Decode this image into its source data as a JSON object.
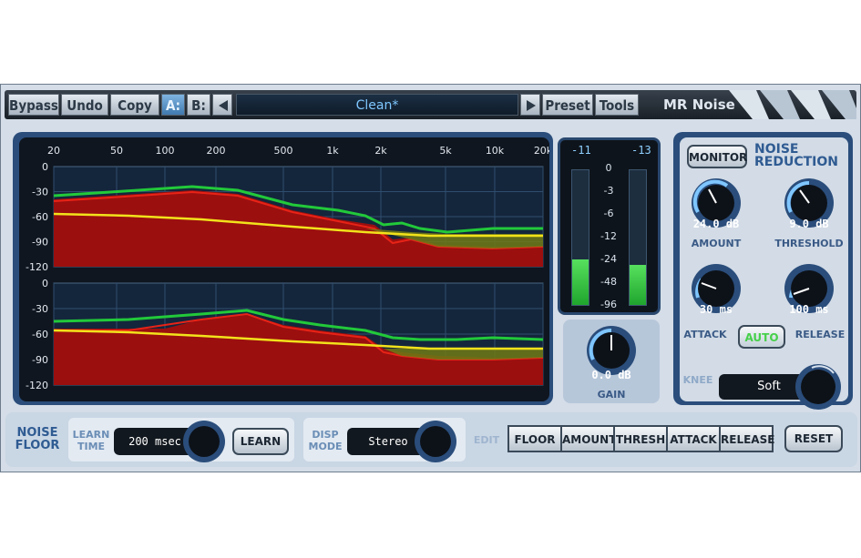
{
  "toolbar": {
    "bypass": "Bypass",
    "undo": "Undo",
    "copy": "Copy",
    "ab_a": "A:",
    "ab_b": "B:",
    "preset_name": "Clean*",
    "preset": "Preset",
    "tools": "Tools",
    "product": "MR Noise"
  },
  "analyzer": {
    "freq_labels": [
      "20",
      "50",
      "100",
      "200",
      "500",
      "1k",
      "2k",
      "5k",
      "10k",
      "20k"
    ],
    "db_labels": [
      "0",
      "-30",
      "-60",
      "-90",
      "-120"
    ]
  },
  "meter": {
    "peak_left": "-11",
    "peak_right": "-13",
    "scale": [
      "0",
      "-3",
      "-6",
      "-12",
      "-24",
      "-48",
      "-96"
    ],
    "level_left": 0.34,
    "level_right": 0.3
  },
  "gain": {
    "value": "0.0 dB",
    "label": "GAIN"
  },
  "noise_reduction": {
    "title_line1": "NOISE",
    "title_line2": "REDUCTION",
    "monitor": "MONITOR",
    "amount": {
      "value": "24.0 dB",
      "label": "AMOUNT"
    },
    "threshold": {
      "value": "9.0 dB",
      "label": "THRESHOLD"
    },
    "attack": {
      "value": "30 ms",
      "label": "ATTACK"
    },
    "release": {
      "value": "100 ms",
      "label": "RELEASE"
    },
    "auto": "AUTO",
    "knee_label": "KNEE",
    "knee_value": "Soft"
  },
  "bottom": {
    "noise_floor_1": "NOISE",
    "noise_floor_2": "FLOOR",
    "learn_time_1": "LEARN",
    "learn_time_2": "TIME",
    "learn_time_value": "200 msec",
    "learn": "LEARN",
    "disp_mode_1": "DISP",
    "disp_mode_2": "MODE",
    "disp_mode_value": "Stereo",
    "edit": "EDIT",
    "edit_buttons": [
      "FLOOR",
      "AMOUNT",
      "THRESH",
      "ATTACK",
      "RELEASE"
    ],
    "reset": "RESET"
  },
  "colors": {
    "signal": "#22c93a",
    "reduced": "#9b0f0f",
    "threshold": "#f2e21b",
    "accent": "#2a4d7b"
  }
}
